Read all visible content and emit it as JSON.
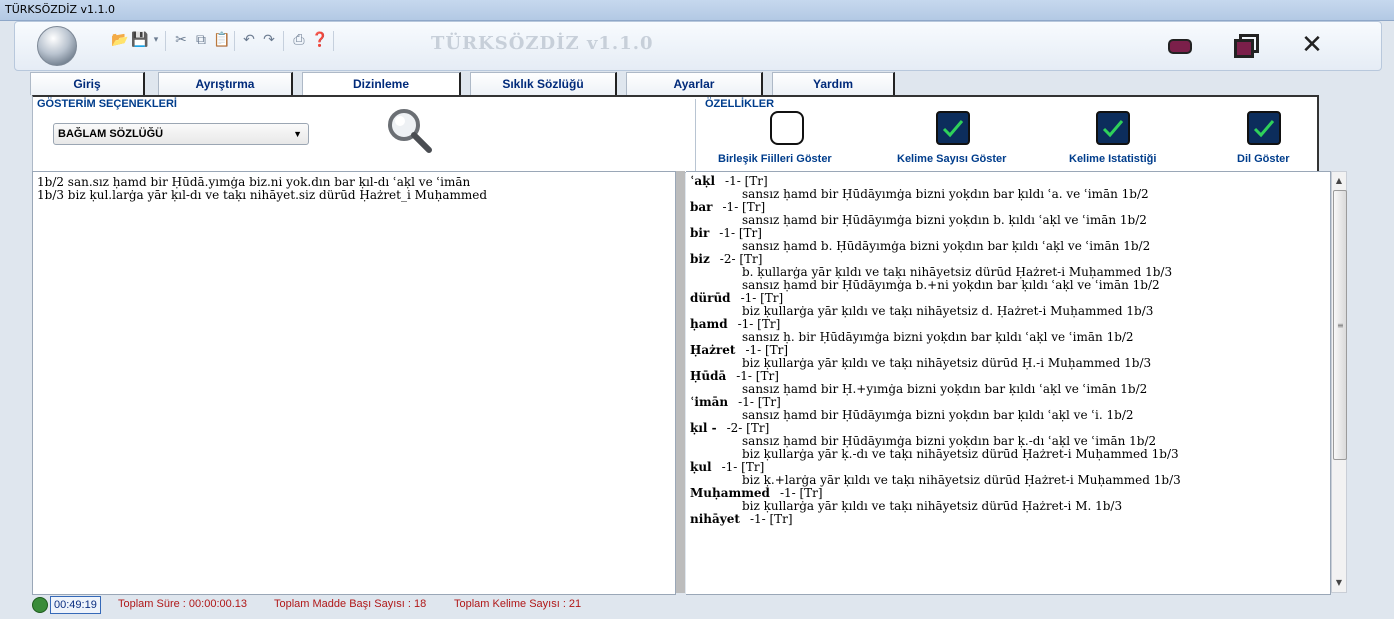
{
  "window": {
    "title": "TÜRKSÖZDİZ v1.1.0",
    "app_title": "TÜRKSÖZDİZ v1.1.0"
  },
  "toolbar": {
    "icons": [
      "folder-open-icon",
      "save-icon",
      "cut-icon",
      "copy-icon",
      "paste-icon",
      "undo-icon",
      "redo-icon",
      "print-icon",
      "help-icon"
    ]
  },
  "tabs": [
    "Giriş",
    "Ayrıştırma",
    "Dizinleme",
    "Sıklık Sözlüğü",
    "Ayarlar",
    "Yardım"
  ],
  "active_tab": "Dizinleme",
  "display_options": {
    "title": "GÖSTERİM SEÇENEKLERİ",
    "selected": "BAĞLAM SÖZLÜĞÜ"
  },
  "features": {
    "title": "ÖZELLİKLER",
    "items": [
      {
        "label": "Birleşik Fiilleri Göster",
        "checked": false
      },
      {
        "label": "Kelime Sayısı Göster",
        "checked": true
      },
      {
        "label": "Kelime Istatistiği",
        "checked": true
      },
      {
        "label": "Dil Göster",
        "checked": true
      }
    ]
  },
  "left_text": [
    "1b/2 san.sız ḥamd bir Ḥūdā.yımġa biz.ni yok.dın bar ḳıl-dı ʿaḳl ve ʿimān",
    "1b/3 biz ḳul.larġa yār ḳıl-dı ve taḳı nihāyet.siz dürūd Ḥażret_i Muḥammed"
  ],
  "index_entries": [
    {
      "head": "ʿaḳl",
      "tag": "-1- [Tr]",
      "lines": [
        "sansız ḥamd bir Ḥūdāyımġa bizni yoḳdın bar ḳıldı ʿa. ve ʿimān 1b/2"
      ]
    },
    {
      "head": "bar",
      "tag": "-1- [Tr]",
      "lines": [
        "sansız ḥamd bir Ḥūdāyımġa bizni yoḳdın b. ḳıldı ʿaḳl ve ʿimān 1b/2"
      ]
    },
    {
      "head": "bir",
      "tag": "-1- [Tr]",
      "lines": [
        "sansız ḥamd b. Ḥūdāyımġa bizni yoḳdın bar ḳıldı ʿaḳl ve ʿimān 1b/2"
      ]
    },
    {
      "head": "biz",
      "tag": "-2- [Tr]",
      "lines": [
        "b. ḳullarġa yār ḳıldı ve taḳı nihāyetsiz dürūd Ḥażret-i Muḥammed 1b/3",
        "sansız ḥamd bir Ḥūdāyımġa b.+ni yoḳdın bar ḳıldı ʿaḳl ve ʿimān 1b/2"
      ]
    },
    {
      "head": "dürūd",
      "tag": "-1- [Tr]",
      "lines": [
        "biz ḳullarġa yār ḳıldı ve taḳı nihāyetsiz d. Ḥażret-i Muḥammed 1b/3"
      ]
    },
    {
      "head": "ḥamd",
      "tag": "-1- [Tr]",
      "lines": [
        "sansız ḥ. bir Ḥūdāyımġa bizni yoḳdın bar ḳıldı ʿaḳl ve ʿimān 1b/2"
      ]
    },
    {
      "head": "Ḥażret",
      "tag": "-1- [Tr]",
      "lines": [
        "biz ḳullarġa yār ḳıldı ve taḳı nihāyetsiz dürūd Ḥ.-i Muḥammed 1b/3"
      ]
    },
    {
      "head": "Ḥūdā",
      "tag": "-1- [Tr]",
      "lines": [
        "sansız ḥamd bir Ḥ.+yımġa bizni yoḳdın bar ḳıldı ʿaḳl ve ʿimān 1b/2"
      ]
    },
    {
      "head": "ʿimān",
      "tag": "-1- [Tr]",
      "lines": [
        "sansız ḥamd bir Ḥūdāyımġa bizni yoḳdın bar ḳıldı ʿaḳl ve ʿi. 1b/2"
      ]
    },
    {
      "head": "ḳıl -",
      "tag": "-2- [Tr]",
      "lines": [
        "sansız ḥamd bir Ḥūdāyımġa bizni yoḳdın bar ḳ.-dı ʿaḳl ve ʿimān 1b/2",
        "biz ḳullarġa yār ḳ.-dı ve taḳı nihāyetsiz dürūd Ḥażret-i Muḥammed 1b/3"
      ]
    },
    {
      "head": "ḳul",
      "tag": "-1- [Tr]",
      "lines": [
        "biz ḳ.+larġa yār ḳıldı ve taḳı nihāyetsiz dürūd Ḥażret-i Muḥammed 1b/3"
      ]
    },
    {
      "head": "Muḥammed",
      "tag": "-1- [Tr]",
      "lines": [
        "biz ḳullarġa yār ḳıldı ve taḳı nihāyetsiz dürūd Ḥażret-i M. 1b/3"
      ]
    },
    {
      "head": "nihāyet",
      "tag": "-1- [Tr]",
      "lines": []
    }
  ],
  "status": {
    "time": "00:49:19",
    "total_time": "Toplam Süre : 00:00:00.13",
    "headword_count": "Toplam Madde Başı Sayısı : 18",
    "word_count": "Toplam Kelime Sayısı : 21"
  },
  "colors": {
    "accent": "#003d8c",
    "status_text": "#b01818",
    "checkbox_fill": "#0c2d5c",
    "check": "#2fd15a"
  }
}
